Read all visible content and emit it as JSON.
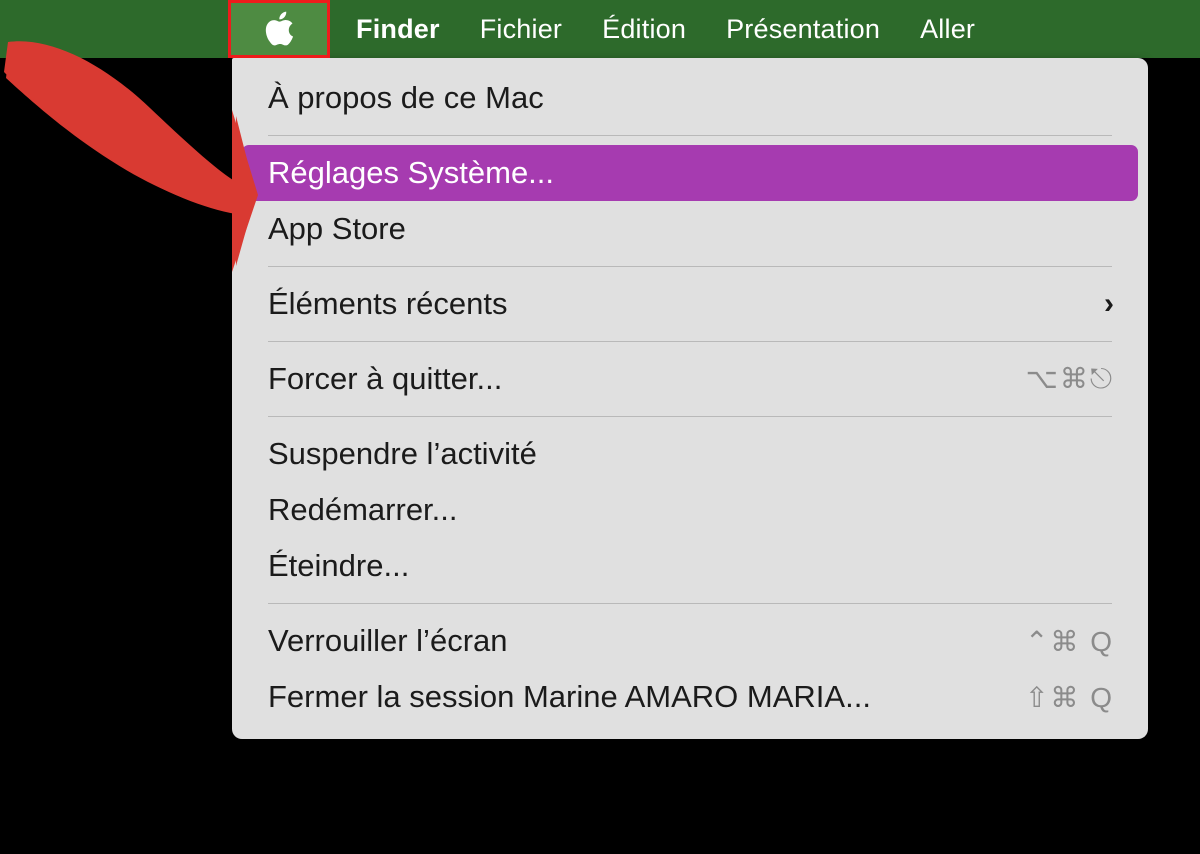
{
  "menubar": {
    "apple_icon": "apple-logo-icon",
    "items": [
      {
        "label": "Finder",
        "bold": true
      },
      {
        "label": "Fichier",
        "bold": false
      },
      {
        "label": "Édition",
        "bold": false
      },
      {
        "label": "Présentation",
        "bold": false
      },
      {
        "label": "Aller",
        "bold": false
      }
    ],
    "background_color": "#2d6a2b",
    "highlight_color": "#4e8b42",
    "annotation_border_color": "#ee1c1c"
  },
  "apple_menu": {
    "background_color": "#e0e0e0",
    "selected_color": "#a63bb0",
    "rows": [
      {
        "label": "À propos de ce Mac",
        "shortcut": "",
        "chevron": "",
        "selected": false
      },
      {
        "label": "Réglages Système...",
        "shortcut": "",
        "chevron": "",
        "selected": true
      },
      {
        "label": "App Store",
        "shortcut": "",
        "chevron": "",
        "selected": false
      },
      {
        "label": "Éléments récents",
        "shortcut": "",
        "chevron": "›",
        "selected": false
      },
      {
        "label": "Forcer à quitter...",
        "shortcut": "⌥⌘⎋",
        "chevron": "",
        "selected": false
      },
      {
        "label": "Suspendre l’activité",
        "shortcut": "",
        "chevron": "",
        "selected": false
      },
      {
        "label": "Redémarrer...",
        "shortcut": "",
        "chevron": "",
        "selected": false
      },
      {
        "label": "Éteindre...",
        "shortcut": "",
        "chevron": "",
        "selected": false
      },
      {
        "label": "Verrouiller l’écran",
        "shortcut": "⌃⌘ Q",
        "chevron": "",
        "selected": false
      },
      {
        "label": "Fermer la session Marine AMARO MARIA...",
        "shortcut": "⇧⌘ Q",
        "chevron": "",
        "selected": false
      }
    ]
  },
  "annotation": {
    "arrow_name": "red-curved-arrow",
    "arrow_color": "#d93a32",
    "points_at": "Réglages Système..."
  }
}
